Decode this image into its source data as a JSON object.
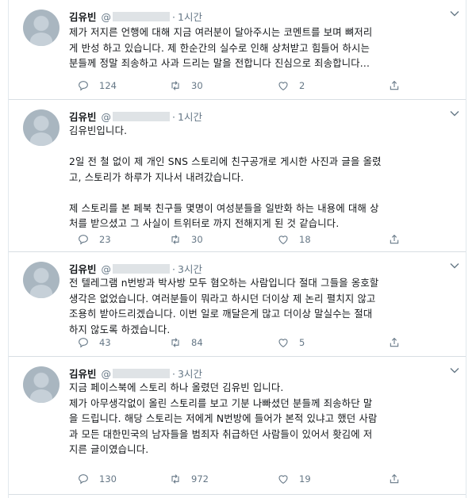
{
  "tweets": [
    {
      "name": "김유빈",
      "handle_prefix": "@",
      "time": "1시간",
      "lines": [
        "제가 저지른 언행에 대해 지금 여러분이 달아주시는 코멘트를 보며 뼈저리",
        "게 반성 하고 있습니다. 제 한순간의 실수로 인해 상처받고 힘들어 하시는",
        "분들께 정말 죄송하고 사과 드리는 말을 전합니다 진심으로 죄송합니다..."
      ],
      "replies": "124",
      "retweets": "30",
      "likes": "2"
    },
    {
      "name": "김유빈",
      "handle_prefix": "@",
      "time": "1시간",
      "lines": [
        "김유빈입니다.",
        "",
        "2일 전 철 없이 제 개인 SNS 스토리에 친구공개로 게시한 사진과 글을 올렸",
        "고, 스토리가 하루가 지나서 내려갔습니다.",
        "",
        "제 스토리를 본 페북 친구들 몇명이 여성분들을 일반화 하는 내용에 대해 상",
        "처를 받으셨고 그 사실이 트위터로 까지 전해지게 된 것 같습니다."
      ],
      "replies": "23",
      "retweets": "30",
      "likes": "18"
    },
    {
      "name": "김유빈",
      "handle_prefix": "@",
      "time": "3시간",
      "lines": [
        "전 텔레그램 n번방과 박사방 모두 혐오하는 사람입니다 절대 그들을 옹호할",
        "생각은 없었습니다. 여러분들이 뭐라고 하시던 더이상 제 논리 펼치지 않고",
        "조용히 받아드리겠습니다. 이번 일로 깨달은게 많고 더이상 말실수는 절대",
        "하지 않도록 하겠습니다."
      ],
      "replies": "43",
      "retweets": "84",
      "likes": "5"
    },
    {
      "name": "김유빈",
      "handle_prefix": "@",
      "time": "3시간",
      "lines": [
        "지금 페이스북에 스토리 하나 올렸던 김유빈 입니다.",
        "제가 아무생각없이 올린 스토리를 보고 기분 나빠셨던 분들께 죄송하단 말",
        "을 드립니다. 해당 스토리는 저에게 N번방에 들어가 본적 있냐고 했던 사람",
        "과 모든 대한민국의 남자들을 범죄자 취급하던 사람들이 있어서 홧김에 저",
        "지른 글이였습니다."
      ],
      "replies": "130",
      "retweets": "972",
      "likes": "19"
    }
  ],
  "icons": {
    "reply": "reply-icon",
    "retweet": "retweet-icon",
    "like": "heart-icon",
    "share": "share-icon",
    "caret": "chevron-down-icon"
  },
  "colors": {
    "text": "#14171a",
    "secondary": "#657786",
    "border": "#e1e8ed"
  }
}
